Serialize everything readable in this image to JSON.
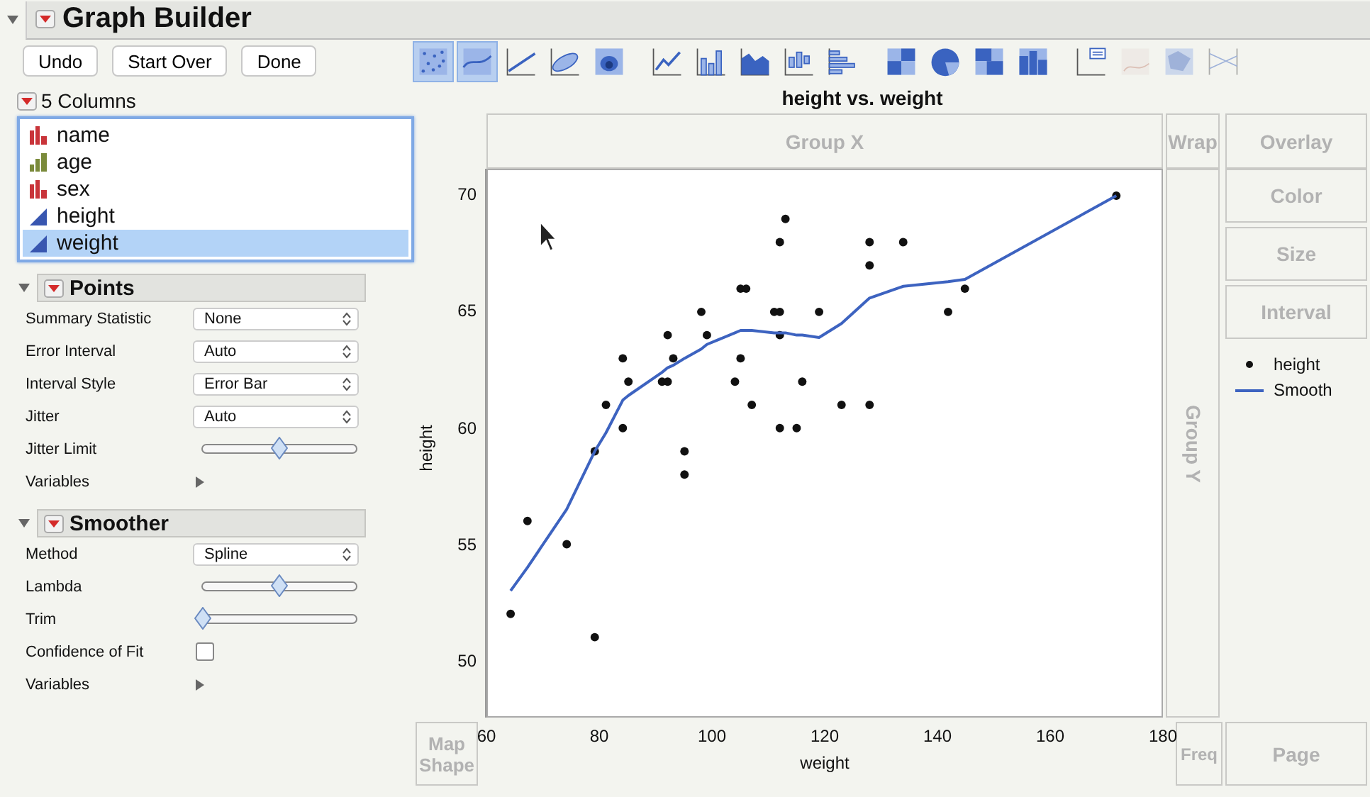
{
  "window": {
    "title": "Graph Builder",
    "expanded": true
  },
  "buttons": [
    "Undo",
    "Start Over",
    "Done"
  ],
  "toolbar": [
    {
      "kind": "points",
      "selected": true,
      "disabled": false
    },
    {
      "kind": "smoother",
      "selected": true,
      "disabled": false
    },
    {
      "kind": "line_of_fit",
      "selected": false,
      "disabled": false
    },
    {
      "kind": "ellipse",
      "selected": false,
      "disabled": false
    },
    {
      "kind": "contour",
      "selected": false,
      "disabled": false
    },
    {
      "kind": "line",
      "selected": false,
      "disabled": false
    },
    {
      "kind": "bar",
      "selected": false,
      "disabled": false
    },
    {
      "kind": "area",
      "selected": false,
      "disabled": false
    },
    {
      "kind": "box",
      "selected": false,
      "disabled": false
    },
    {
      "kind": "histogram",
      "selected": false,
      "disabled": false
    },
    {
      "kind": "heatmap",
      "selected": false,
      "disabled": false
    },
    {
      "kind": "pie",
      "selected": false,
      "disabled": false
    },
    {
      "kind": "treemap",
      "selected": false,
      "disabled": false
    },
    {
      "kind": "mosaic",
      "selected": false,
      "disabled": false
    },
    {
      "kind": "caption",
      "selected": false,
      "disabled": false
    },
    {
      "kind": "formula",
      "selected": false,
      "disabled": true
    },
    {
      "kind": "map",
      "selected": false,
      "disabled": true
    },
    {
      "kind": "parallel",
      "selected": false,
      "disabled": true
    }
  ],
  "columns": {
    "title": "5 Columns",
    "items": [
      {
        "name": "name",
        "kind": "nominal",
        "selected": false
      },
      {
        "name": "age",
        "kind": "ordinal",
        "selected": false
      },
      {
        "name": "sex",
        "kind": "nominal",
        "selected": false
      },
      {
        "name": "height",
        "kind": "continuous",
        "selected": false
      },
      {
        "name": "weight",
        "kind": "continuous",
        "selected": true
      }
    ]
  },
  "sections": [
    {
      "title": "Points",
      "expanded": true,
      "rows": [
        {
          "kind": "select",
          "label": "Summary Statistic",
          "value": "None"
        },
        {
          "kind": "select",
          "label": "Error Interval",
          "value": "Auto"
        },
        {
          "kind": "select",
          "label": "Interval Style",
          "value": "Error Bar"
        },
        {
          "kind": "select",
          "label": "Jitter",
          "value": "Auto"
        },
        {
          "kind": "slider",
          "label": "Jitter Limit",
          "level": 0.5
        },
        {
          "kind": "disclosure",
          "label": "Variables",
          "expanded": false
        }
      ]
    },
    {
      "title": "Smoother",
      "expanded": true,
      "rows": [
        {
          "kind": "select",
          "label": "Method",
          "value": "Spline"
        },
        {
          "kind": "slider",
          "label": "Lambda",
          "level": 0.5
        },
        {
          "kind": "slider",
          "label": "Trim",
          "level": 0.0
        },
        {
          "kind": "checkbox",
          "label": "Confidence of Fit",
          "checked": false
        },
        {
          "kind": "disclosure",
          "label": "Variables",
          "expanded": false
        }
      ]
    }
  ],
  "graph": {
    "title": "height vs. weight",
    "zones": [
      {
        "kind": "group_x",
        "label": "Group X"
      },
      {
        "kind": "wrap",
        "label": "Wrap"
      },
      {
        "kind": "overlay",
        "label": "Overlay"
      },
      {
        "kind": "group_y",
        "label": "Group Y"
      },
      {
        "kind": "color",
        "label": "Color"
      },
      {
        "kind": "size",
        "label": "Size"
      },
      {
        "kind": "interval",
        "label": "Interval"
      },
      {
        "kind": "map_shape",
        "label": "Map Shape"
      },
      {
        "kind": "freq",
        "label": "Freq"
      },
      {
        "kind": "page",
        "label": "Page"
      }
    ],
    "chart_data": {
      "type": "scatter",
      "legend": true,
      "xlabel": "weight",
      "ylabel": "height",
      "xlim": [
        60,
        180
      ],
      "ylim": [
        47.6,
        71.1
      ],
      "xticks": [
        60,
        80,
        100,
        120,
        140,
        160,
        180
      ],
      "yticks": [
        50,
        55,
        60,
        65,
        70
      ],
      "x": [
        64,
        67,
        74,
        79,
        79,
        81,
        84,
        84,
        85,
        91,
        92,
        92,
        93,
        95,
        95,
        98,
        99,
        104,
        105,
        105,
        106,
        107,
        111,
        112,
        112,
        112,
        112,
        113,
        115,
        116,
        119,
        123,
        128,
        128,
        128,
        134,
        142,
        145,
        172
      ],
      "series": [
        {
          "name": "height",
          "type": "scatter",
          "color": "#111111",
          "values": [
            52,
            56,
            55,
            59,
            51,
            61,
            60,
            63,
            62,
            62,
            62,
            64,
            63,
            59,
            58,
            65,
            64,
            62,
            63,
            66,
            66,
            61,
            65,
            65,
            64,
            68,
            60,
            69,
            60,
            62,
            65,
            61,
            68,
            67,
            61,
            68,
            65,
            66,
            70
          ]
        },
        {
          "name": "Smooth",
          "type": "line",
          "color": "#3d63c0",
          "values": [
            53,
            54,
            56.5,
            59,
            59,
            59.8,
            61.2,
            61.2,
            61.4,
            62.4,
            62.6,
            62.6,
            62.7,
            63,
            63,
            63.4,
            63.6,
            64.1,
            64.2,
            64.2,
            64.2,
            64.2,
            64.1,
            64.1,
            64.1,
            64.1,
            64.1,
            64.1,
            64,
            64,
            63.9,
            64.5,
            65.6,
            65.6,
            65.6,
            66.1,
            66.3,
            66.4,
            70
          ]
        }
      ]
    }
  }
}
